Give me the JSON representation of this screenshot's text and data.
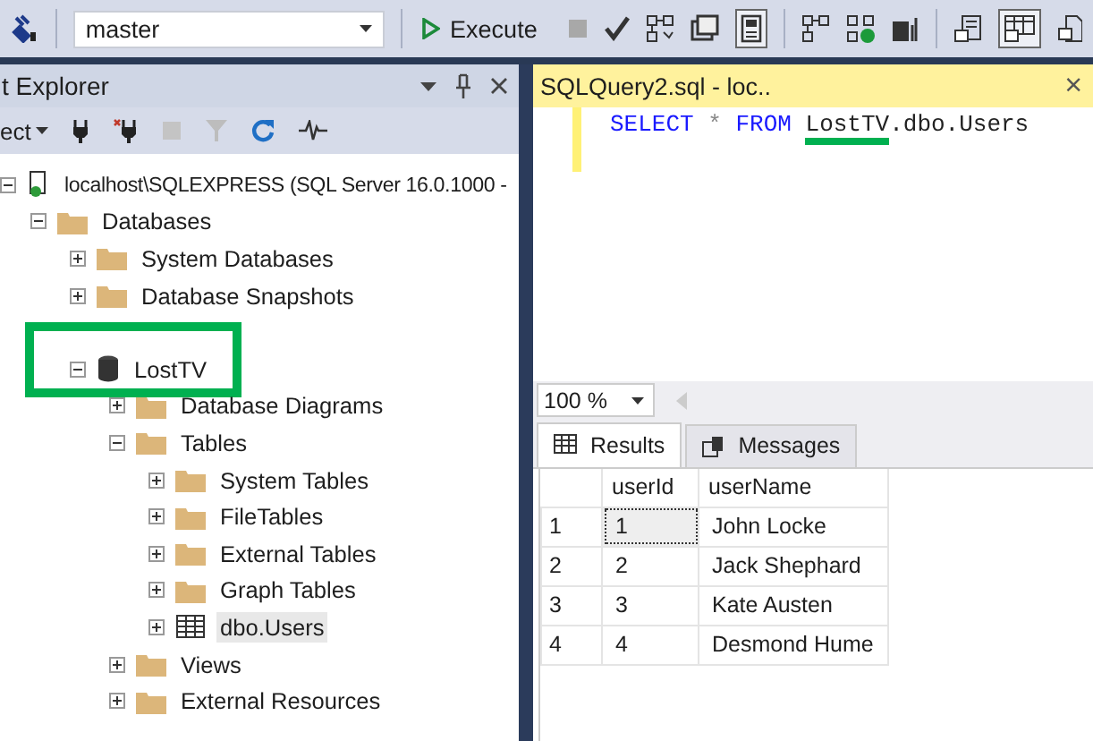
{
  "toolbar": {
    "database_combo": {
      "value": "master"
    },
    "execute_label": "Execute"
  },
  "object_explorer": {
    "title": "t Explorer",
    "connect_label": "ect",
    "tree": [
      {
        "label": "localhost\\SQLEXPRESS (SQL Server 16.0.1000 -",
        "kind": "server",
        "expanded": true,
        "selected": false,
        "highlighted": false,
        "children": [
          {
            "label": "Databases",
            "kind": "folder",
            "expanded": true,
            "selected": false,
            "highlighted": false,
            "children": [
              {
                "label": "System Databases",
                "kind": "folder",
                "expanded": false,
                "selected": false,
                "highlighted": false
              },
              {
                "label": "Database Snapshots",
                "kind": "folder",
                "expanded": false,
                "selected": false,
                "highlighted": false
              },
              {
                "kind": "hidden"
              },
              {
                "label": "LostTV",
                "kind": "database",
                "expanded": true,
                "selected": false,
                "highlighted": true,
                "children": [
                  {
                    "label": "Database Diagrams",
                    "kind": "folder",
                    "expanded": false,
                    "selected": false,
                    "highlighted": false
                  },
                  {
                    "label": "Tables",
                    "kind": "folder",
                    "expanded": true,
                    "selected": false,
                    "highlighted": false,
                    "children": [
                      {
                        "label": "System Tables",
                        "kind": "folder",
                        "expanded": false,
                        "selected": false,
                        "highlighted": false
                      },
                      {
                        "label": "FileTables",
                        "kind": "folder",
                        "expanded": false,
                        "selected": false,
                        "highlighted": false
                      },
                      {
                        "label": "External Tables",
                        "kind": "folder",
                        "expanded": false,
                        "selected": false,
                        "highlighted": false
                      },
                      {
                        "label": "Graph Tables",
                        "kind": "folder",
                        "expanded": false,
                        "selected": false,
                        "highlighted": false
                      },
                      {
                        "label": "dbo.Users",
                        "kind": "table",
                        "expanded": false,
                        "selected": true,
                        "highlighted": false
                      }
                    ]
                  },
                  {
                    "label": "Views",
                    "kind": "folder",
                    "expanded": false,
                    "selected": false,
                    "highlighted": false
                  },
                  {
                    "label": "External Resources",
                    "kind": "folder",
                    "expanded": false,
                    "selected": false,
                    "highlighted": false
                  }
                ]
              }
            ]
          }
        ]
      }
    ]
  },
  "editor": {
    "tab_title": "SQLQuery2.sql - loc..",
    "close": "×",
    "code": [
      {
        "text": "SELECT",
        "kind": "keyword"
      },
      {
        "text": "*",
        "kind": "operator"
      },
      {
        "text": "FROM",
        "kind": "keyword"
      },
      {
        "text": "LostTV",
        "kind": "identifier",
        "underlined": true
      },
      {
        "text": ".dbo.Users",
        "kind": "identifier",
        "underlined": false
      }
    ],
    "zoom": "100 %"
  },
  "results": {
    "tabs": [
      {
        "label": "Results",
        "kind": "grid",
        "selected": true
      },
      {
        "label": "Messages",
        "kind": "messages",
        "selected": false
      }
    ],
    "columns": [
      "userId",
      "userName"
    ],
    "rows": [
      {
        "number": "1",
        "cells": [
          "1",
          "John Locke"
        ]
      },
      {
        "number": "2",
        "cells": [
          "2",
          "Jack Shephard"
        ]
      },
      {
        "number": "3",
        "cells": [
          "3",
          "Kate Austen"
        ]
      },
      {
        "number": "4",
        "cells": [
          "4",
          "Desmond Hume"
        ]
      }
    ]
  }
}
